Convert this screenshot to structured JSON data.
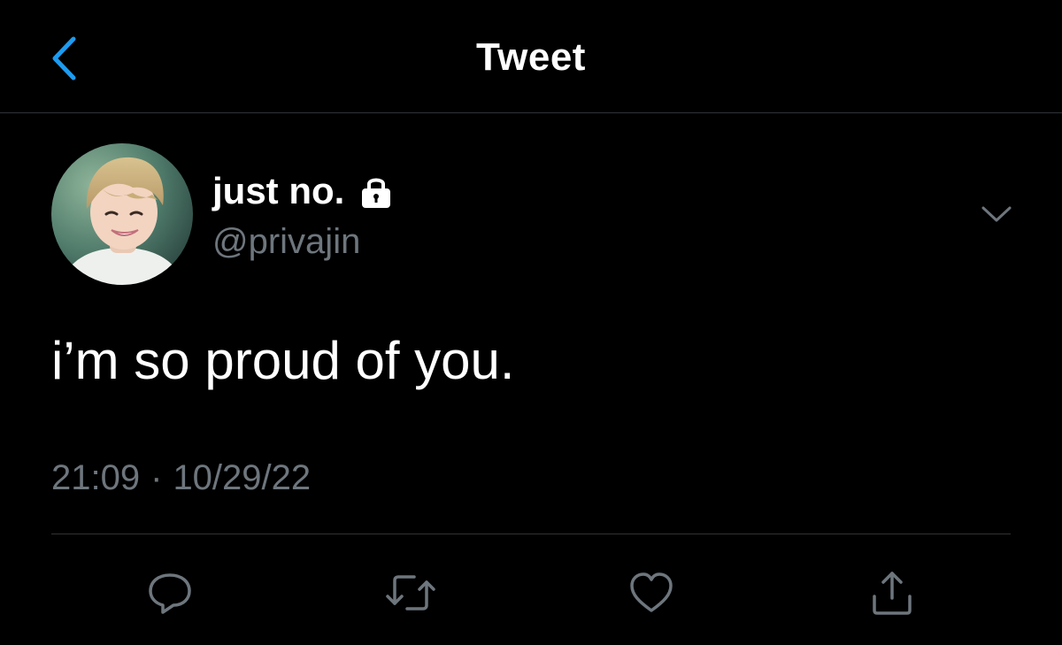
{
  "header": {
    "title": "Tweet",
    "back_icon": "chevron-left-icon",
    "accent_color": "#1d9bf0"
  },
  "tweet": {
    "display_name": "just no.",
    "protected_icon": "lock-icon",
    "handle": "@privajin",
    "menu_icon": "chevron-down-icon",
    "text": "i’m so proud of you.",
    "time": "21:09",
    "separator": "·",
    "date": "10/29/22"
  },
  "actions": [
    {
      "icon": "reply-icon"
    },
    {
      "icon": "retweet-icon"
    },
    {
      "icon": "like-icon"
    },
    {
      "icon": "share-icon"
    }
  ],
  "colors": {
    "background": "#000000",
    "text_primary": "#ffffff",
    "text_secondary": "#6e767d",
    "divider": "#2f3336"
  }
}
